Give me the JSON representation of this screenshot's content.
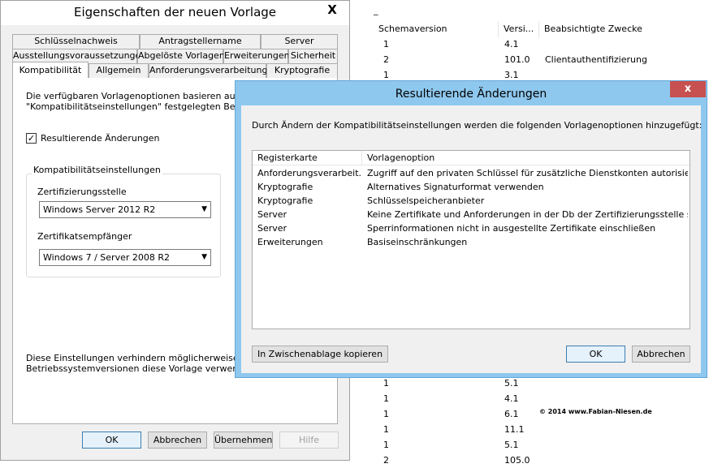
{
  "background": {
    "dash": "_",
    "columns": [
      "Schemaversion",
      "Versi...",
      "Beabsichtigte Zwecke"
    ],
    "rows_top": [
      {
        "schema": "1",
        "version": "4.1",
        "purpose": ""
      },
      {
        "schema": "2",
        "version": "101.0",
        "purpose": "Clientauthentifizierung"
      },
      {
        "schema": "1",
        "version": "3.1",
        "purpose": ""
      }
    ],
    "rows_bottom": [
      {
        "schema": "1",
        "version": "5.1"
      },
      {
        "schema": "1",
        "version": "4.1"
      },
      {
        "schema": "1",
        "version": "6.1"
      },
      {
        "schema": "1",
        "version": "11.1"
      },
      {
        "schema": "1",
        "version": "5.1"
      },
      {
        "schema": "2",
        "version": "105.0"
      }
    ],
    "copyright": "© 2014 www.Fabian-Niesen.de"
  },
  "left_dialog": {
    "title": "Eigenschaften der neuen Vorlage",
    "close": "X",
    "tabs_row1": [
      "Schlüsselnachweis",
      "Antragstellername",
      "Server"
    ],
    "tabs_row2": [
      "Ausstellungsvoraussetzungen",
      "Abgelöste Vorlagen",
      "Erweiterungen",
      "Sicherheit"
    ],
    "tabs_row3": [
      "Kompatibilität",
      "Allgemein",
      "Anforderungsverarbeitung",
      "Kryptografie"
    ],
    "desc_line1": "Die verfügbaren Vorlagenoptionen basieren auf den frü",
    "desc_line2": "\"Kompatibilitätseinstellungen\" festgelegten Betriebssyst",
    "checkbox_label": "Resultierende Änderungen",
    "checkbox_mark": "✓",
    "group_label": "Kompatibilitätseinstellungen",
    "ca_label": "Zertifizierungsstelle",
    "ca_value": "Windows Server 2012 R2",
    "recipient_label": "Zertifikatsempfänger",
    "recipient_value": "Windows 7 / Server 2008 R2",
    "footer_line1": "Diese Einstellungen verhindern möglicherweise nicht, da",
    "footer_line2": "Betriebssystemversionen diese Vorlage verwenden.",
    "buttons": {
      "ok": "OK",
      "cancel": "Abbrechen",
      "apply": "Übernehmen",
      "help": "Hilfe"
    }
  },
  "modal": {
    "title": "Resultierende Änderungen",
    "close": "x",
    "intro": "Durch Ändern der Kompatibilitätseinstellungen werden die folgenden Vorlagenoptionen hinzugefügt:",
    "columns": [
      "Registerkarte",
      "Vorlagenoption"
    ],
    "rows": [
      {
        "tab": "Anforderungsverarbeit...",
        "option": "Zugriff auf den privaten Schlüssel für zusätzliche Dienstkonten autorisieren"
      },
      {
        "tab": "Kryptografie",
        "option": "Alternatives Signaturformat verwenden"
      },
      {
        "tab": "Kryptografie",
        "option": "Schlüsselspeicheranbieter"
      },
      {
        "tab": "Server",
        "option": "Keine Zertifikate und Anforderungen in der Db der Zertifizierungsstelle speichern"
      },
      {
        "tab": "Server",
        "option": "Sperrinformationen nicht in ausgestellte Zertifikate einschließen"
      },
      {
        "tab": "Erweiterungen",
        "option": "Basiseinschränkungen"
      }
    ],
    "buttons": {
      "copy": "In Zwischenablage kopieren",
      "ok": "OK",
      "cancel": "Abbrechen"
    }
  }
}
